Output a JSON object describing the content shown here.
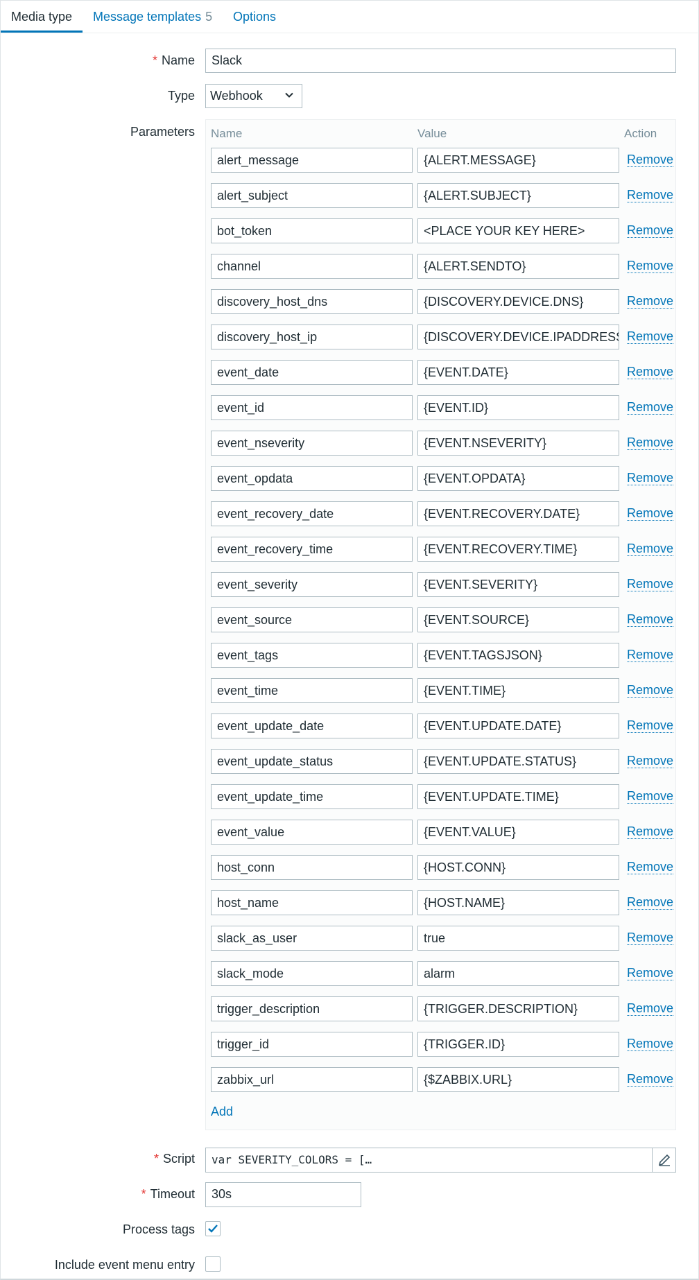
{
  "tabs": {
    "media_type": "Media type",
    "message_templates": "Message templates",
    "message_templates_count": "5",
    "options": "Options"
  },
  "form": {
    "name_label": "Name",
    "name_value": "Slack",
    "type_label": "Type",
    "type_value": "Webhook",
    "parameters_label": "Parameters",
    "script_label": "Script",
    "script_value": "var SEVERITY_COLORS = […",
    "timeout_label": "Timeout",
    "timeout_value": "30s",
    "process_tags_label": "Process tags",
    "process_tags_checked": true,
    "include_event_menu_label": "Include event menu entry",
    "include_event_menu_checked": false
  },
  "parameters": {
    "header_name": "Name",
    "header_value": "Value",
    "header_action": "Action",
    "remove_label": "Remove",
    "add_label": "Add",
    "rows": [
      {
        "name": "alert_message",
        "value": "{ALERT.MESSAGE}"
      },
      {
        "name": "alert_subject",
        "value": "{ALERT.SUBJECT}"
      },
      {
        "name": "bot_token",
        "value": "<PLACE YOUR KEY HERE>"
      },
      {
        "name": "channel",
        "value": "{ALERT.SENDTO}"
      },
      {
        "name": "discovery_host_dns",
        "value": "{DISCOVERY.DEVICE.DNS}"
      },
      {
        "name": "discovery_host_ip",
        "value": "{DISCOVERY.DEVICE.IPADDRESS}"
      },
      {
        "name": "event_date",
        "value": "{EVENT.DATE}"
      },
      {
        "name": "event_id",
        "value": "{EVENT.ID}"
      },
      {
        "name": "event_nseverity",
        "value": "{EVENT.NSEVERITY}"
      },
      {
        "name": "event_opdata",
        "value": "{EVENT.OPDATA}"
      },
      {
        "name": "event_recovery_date",
        "value": "{EVENT.RECOVERY.DATE}"
      },
      {
        "name": "event_recovery_time",
        "value": "{EVENT.RECOVERY.TIME}"
      },
      {
        "name": "event_severity",
        "value": "{EVENT.SEVERITY}"
      },
      {
        "name": "event_source",
        "value": "{EVENT.SOURCE}"
      },
      {
        "name": "event_tags",
        "value": "{EVENT.TAGSJSON}"
      },
      {
        "name": "event_time",
        "value": "{EVENT.TIME}"
      },
      {
        "name": "event_update_date",
        "value": "{EVENT.UPDATE.DATE}"
      },
      {
        "name": "event_update_status",
        "value": "{EVENT.UPDATE.STATUS}"
      },
      {
        "name": "event_update_time",
        "value": "{EVENT.UPDATE.TIME}"
      },
      {
        "name": "event_value",
        "value": "{EVENT.VALUE}"
      },
      {
        "name": "host_conn",
        "value": "{HOST.CONN}"
      },
      {
        "name": "host_name",
        "value": "{HOST.NAME}"
      },
      {
        "name": "slack_as_user",
        "value": "true"
      },
      {
        "name": "slack_mode",
        "value": "alarm"
      },
      {
        "name": "trigger_description",
        "value": "{TRIGGER.DESCRIPTION}"
      },
      {
        "name": "trigger_id",
        "value": "{TRIGGER.ID}"
      },
      {
        "name": "zabbix_url",
        "value": "{$ZABBIX.URL}"
      }
    ]
  },
  "colors": {
    "accent": "#0275b8",
    "required": "#e33734",
    "border": "#acbbc2",
    "muted": "#768d99"
  }
}
